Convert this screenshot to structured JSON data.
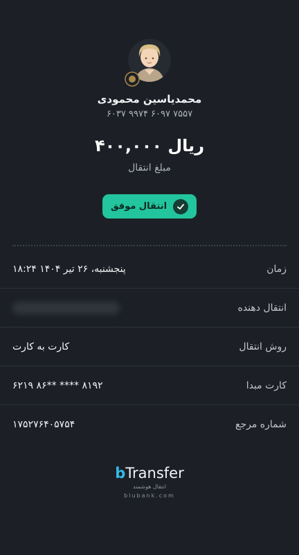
{
  "recipient": {
    "name": "محمدیاسین محمودی",
    "card_number": "۶۰۳۷  ۹۹۷۴  ۶۰۹۷  ۷۵۵۷"
  },
  "amount": {
    "value": "۴۰۰,۰۰۰ ریال",
    "label": "مبلغ انتقال"
  },
  "status": {
    "text": "انتقال موفق",
    "color": "#22c59d"
  },
  "details": [
    {
      "label": "زمان",
      "value": "۱۸:۲۴ پنجشنبه، ۲۶ تیر ۱۴۰۴"
    },
    {
      "label": "انتقال دهنده",
      "value": ""
    },
    {
      "label": "روش انتقال",
      "value": "کارت به کارت"
    },
    {
      "label": "کارت مبدا",
      "value": "۶۲۱۹  ۸۶** ****  ۸۱۹۲"
    },
    {
      "label": "شماره مرجع",
      "value": "۱۷۵۲۷۶۴۰۵۷۵۴"
    }
  ],
  "footer": {
    "logo_b": "b",
    "logo_rest": "Transfer",
    "tagline": "انتقال هوشمند",
    "website": "blubank.com"
  },
  "icons": {
    "avatar": "user-avatar-icon",
    "status": "checkmark-icon"
  }
}
